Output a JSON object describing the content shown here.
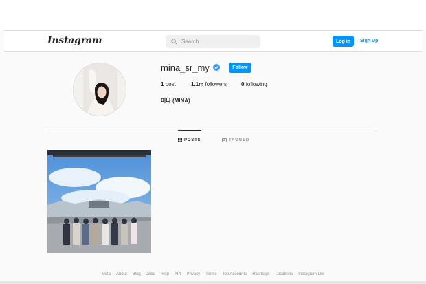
{
  "header": {
    "logo": "Instagram",
    "search_placeholder": "Search",
    "login_label": "Log in",
    "signup_label": "Sign Up"
  },
  "profile": {
    "username": "mina_sr_my",
    "verified": true,
    "follow_label": "Follow",
    "posts_count": "1",
    "posts_label": "post",
    "followers_count": "1.1m",
    "followers_label": "followers",
    "following_count": "0",
    "following_label": "following",
    "full_name": "미나 (MINA)"
  },
  "tabs": [
    {
      "label": "POSTS",
      "icon": "grid-icon",
      "active": true
    },
    {
      "label": "TAGGED",
      "icon": "tag-icon",
      "active": false
    }
  ],
  "footer": {
    "links": [
      "Meta",
      "About",
      "Blog",
      "Jobs",
      "Help",
      "API",
      "Privacy",
      "Terms",
      "Top Accounts",
      "Hashtags",
      "Locations",
      "Instagram Lite"
    ]
  },
  "colors": {
    "accent": "#0095f6",
    "background": "#fafafa",
    "border": "#dbdbdb",
    "muted": "#8e8e8e"
  }
}
